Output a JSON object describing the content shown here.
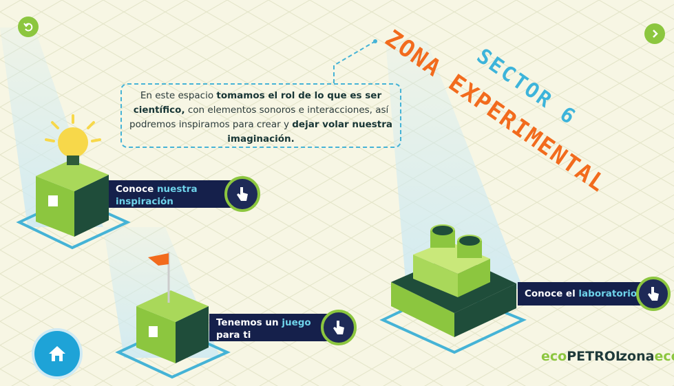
{
  "title": {
    "sector": "SECTOR 6",
    "zona": "ZONA EXPERIMENTAL"
  },
  "info": {
    "p1": "En este espacio ",
    "b1": "tomamos el rol de lo que es ser científico,",
    "p2": " con elementos sonoros e interacciones, así podremos inspiramos para crear y ",
    "b2": "dejar volar nuestra imaginación."
  },
  "stations": {
    "inspiracion": {
      "pre": "Conoce ",
      "hl": "nuestra inspiración"
    },
    "juego": {
      "pre": "Tenemos un ",
      "hl": "juego",
      "post": " para ti"
    },
    "laboratorio": {
      "pre": "Conoce el ",
      "hl": "laboratorio"
    }
  },
  "logos": {
    "ecopetrol_a": "eco",
    "ecopetrol_b": "PETROL",
    "zona_a": "zona",
    "zona_b": "eco"
  },
  "icons": [
    "back-arrow-icon",
    "chevron-right-icon",
    "home-icon",
    "hand-pointer-icon"
  ],
  "colors": {
    "green": "#8cc63f",
    "navy": "#15204b",
    "blue": "#1ea3d7",
    "orange": "#f26b1d",
    "cyan": "#3db4da"
  }
}
